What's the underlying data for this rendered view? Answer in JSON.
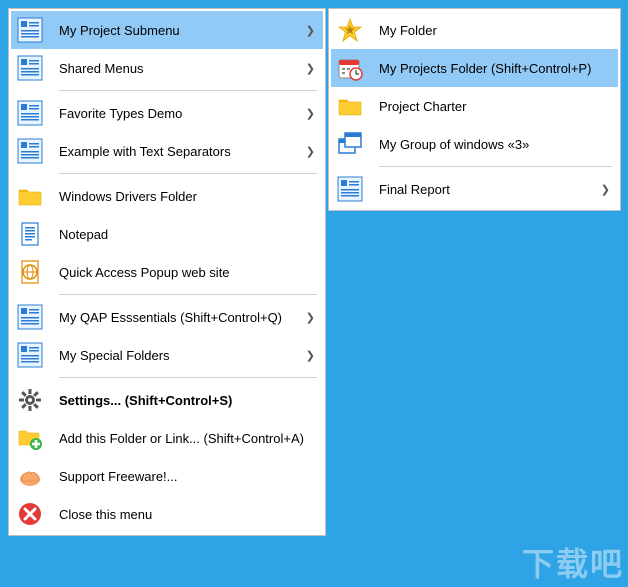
{
  "main_menu": {
    "items": [
      {
        "label": "My Project Submenu",
        "icon": "submenu",
        "has_arrow": true,
        "selected": true
      },
      {
        "label": "Shared Menus",
        "icon": "submenu",
        "has_arrow": true
      },
      {
        "type": "separator"
      },
      {
        "label": "Favorite Types Demo",
        "icon": "submenu",
        "has_arrow": true
      },
      {
        "label": "Example with Text Separators",
        "icon": "submenu",
        "has_arrow": true
      },
      {
        "type": "separator"
      },
      {
        "label": "Windows Drivers Folder",
        "icon": "folder"
      },
      {
        "label": "Notepad",
        "icon": "document"
      },
      {
        "label": "Quick Access Popup web site",
        "icon": "web"
      },
      {
        "type": "separator"
      },
      {
        "label": "My QAP Esssentials (Shift+Control+Q)",
        "icon": "submenu",
        "has_arrow": true
      },
      {
        "label": "My Special Folders",
        "icon": "submenu",
        "has_arrow": true
      },
      {
        "type": "separator"
      },
      {
        "label": "Settings... (Shift+Control+S)",
        "icon": "gear",
        "bold": true
      },
      {
        "label": "Add this Folder or Link... (Shift+Control+A)",
        "icon": "folder-add"
      },
      {
        "label": "Support Freeware!...",
        "icon": "donate"
      },
      {
        "label": "Close this menu",
        "icon": "close"
      }
    ]
  },
  "sub_menu": {
    "items": [
      {
        "label": "My Folder",
        "icon": "star"
      },
      {
        "label": "My Projects Folder (Shift+Control+P)",
        "icon": "calendar",
        "selected": true
      },
      {
        "label": "Project Charter",
        "icon": "folder"
      },
      {
        "label": "My Group of windows «3»",
        "icon": "windows"
      },
      {
        "type": "separator"
      },
      {
        "label": "Final Report",
        "icon": "submenu",
        "has_arrow": true
      }
    ]
  },
  "watermark": "下载吧",
  "arrow_glyph": "❯"
}
